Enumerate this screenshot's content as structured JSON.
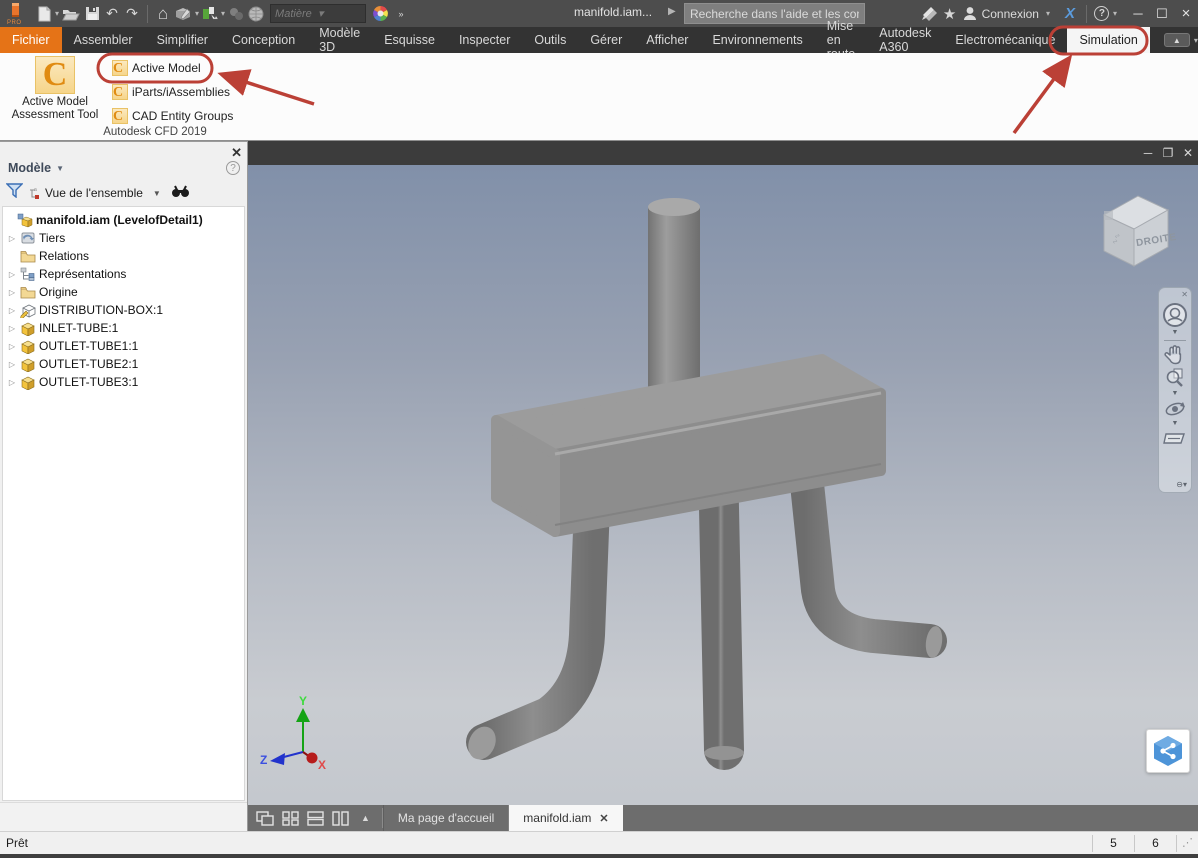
{
  "colors": {
    "accent_orange": "#e57317",
    "annotation_red": "#bb4036",
    "exchange_blue": "#5b9bdc",
    "share_blue": "#4d94d8",
    "titlebar_gray": "#4d4d4d",
    "ribbon_tab_gray": "#333333"
  },
  "title_bar": {
    "app_badge": "PRO",
    "document_title": "manifold.iam...",
    "search_placeholder": "Recherche dans l'aide et les com",
    "material_box_label": "Matière",
    "signin_label": "Connexion",
    "qat_icons": [
      "inventor-logo",
      "new-file",
      "open-file",
      "save",
      "undo",
      "redo",
      "home",
      "mark-menu",
      "assembly-update",
      "constraint-pair",
      "appearance-globe",
      "material-combo",
      "color-wheel",
      "overflow-chevrons"
    ],
    "right_icons": [
      "send-to-a360",
      "favorites-star",
      "user",
      "exchange-apps",
      "help"
    ],
    "window_buttons": [
      "minimize",
      "maximize",
      "close"
    ]
  },
  "ribbon": {
    "tabs": [
      {
        "label": "Fichier"
      },
      {
        "label": "Assembler"
      },
      {
        "label": "Simplifier"
      },
      {
        "label": "Conception"
      },
      {
        "label": "Modèle 3D"
      },
      {
        "label": "Esquisse"
      },
      {
        "label": "Inspecter"
      },
      {
        "label": "Outils"
      },
      {
        "label": "Gérer"
      },
      {
        "label": "Afficher"
      },
      {
        "label": "Environnements"
      },
      {
        "label": "Mise en route"
      },
      {
        "label": "Autodesk A360"
      },
      {
        "label": "Electromécanique"
      },
      {
        "label": "Simulation",
        "active": true
      }
    ],
    "cfd_panel": {
      "large_button_line1": "Active Model",
      "large_button_line2": "Assessment Tool",
      "small_buttons": [
        {
          "label": "Active Model"
        },
        {
          "label": "iParts/iAssemblies"
        },
        {
          "label": "CAD Entity Groups"
        }
      ],
      "panel_title": "Autodesk CFD 2019"
    }
  },
  "browser": {
    "panel_title": "Modèle",
    "view_selector": "Vue de l'ensemble",
    "tree": [
      {
        "label": "manifold.iam (LevelofDetail1)",
        "icon": "assembly-icon",
        "bold": true,
        "expandable": false
      },
      {
        "label": "Tiers",
        "icon": "third-party-icon",
        "expandable": true
      },
      {
        "label": "Relations",
        "icon": "folder-icon",
        "expandable": false
      },
      {
        "label": "Représentations",
        "icon": "representations-icon",
        "expandable": true
      },
      {
        "label": "Origine",
        "icon": "folder-icon",
        "expandable": true
      },
      {
        "label": "DISTRIBUTION-BOX:1",
        "icon": "flexible-part-icon",
        "expandable": true
      },
      {
        "label": "INLET-TUBE:1",
        "icon": "part-icon",
        "expandable": true
      },
      {
        "label": "OUTLET-TUBE1:1",
        "icon": "part-icon",
        "expandable": true
      },
      {
        "label": "OUTLET-TUBE2:1",
        "icon": "part-icon",
        "expandable": true
      },
      {
        "label": "OUTLET-TUBE3:1",
        "icon": "part-icon",
        "expandable": true
      }
    ]
  },
  "viewport": {
    "viewcube_face_label": "DROITE",
    "axis_labels": {
      "x": "X",
      "y": "Y",
      "z": "Z"
    }
  },
  "document_tabs": {
    "home_tab": "Ma page d'accueil",
    "active_tab": "manifold.iam"
  },
  "status_bar": {
    "message": "Prêt",
    "cell_1": "5",
    "cell_2": "6"
  }
}
